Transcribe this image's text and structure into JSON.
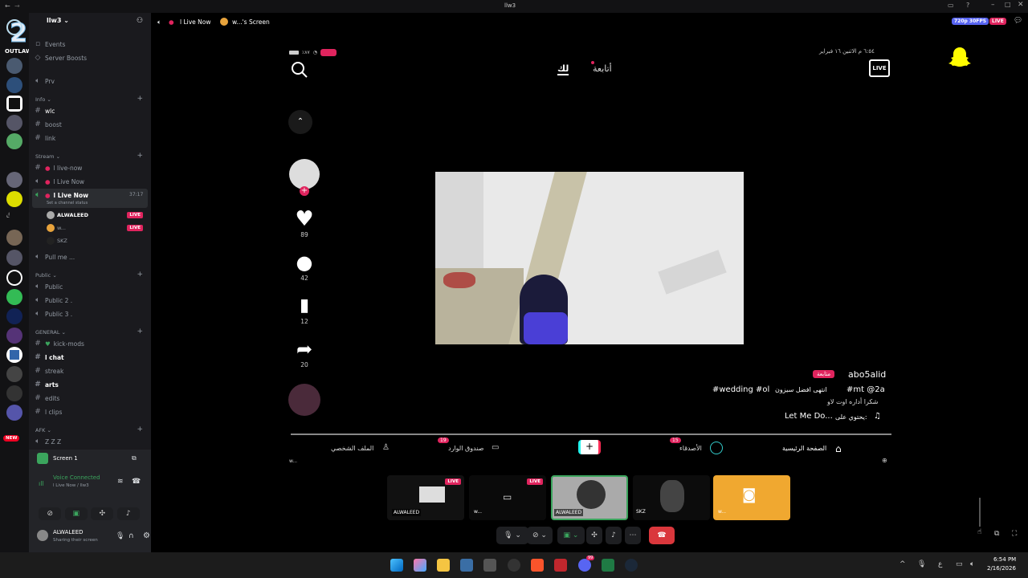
{
  "titlebar": {
    "title": "llw3"
  },
  "guild_logo": {
    "text": "OUTLAW RP"
  },
  "server": {
    "name": "llw3"
  },
  "sidebar": {
    "top_items": [
      {
        "label": "Events"
      },
      {
        "label": "Server Boosts"
      }
    ],
    "prv": {
      "label": "Prv"
    },
    "categories": {
      "info": {
        "label": "Info",
        "channels": [
          {
            "label": "wlc"
          },
          {
            "label": "boost"
          },
          {
            "label": "link"
          }
        ]
      },
      "stream": {
        "label": "Stream",
        "channels": [
          {
            "label": "l live-now"
          },
          {
            "label": "l Live Now"
          },
          {
            "label": "l Live Now"
          }
        ]
      },
      "public": {
        "label": "Public",
        "channels": [
          {
            "label": "Public"
          },
          {
            "label": "Public 2 ."
          },
          {
            "label": "Public 3 ."
          }
        ]
      },
      "general": {
        "label": "GENERAL",
        "channels": [
          {
            "label": "kick-mods"
          },
          {
            "label": "l chat"
          },
          {
            "label": "streak"
          },
          {
            "label": "arts"
          },
          {
            "label": "edits"
          },
          {
            "label": "l clips"
          }
        ]
      },
      "afk": {
        "label": "AFK",
        "channels": [
          {
            "label": "Z Z Z"
          }
        ]
      }
    },
    "active_voice": {
      "timer": "37:17",
      "status": "Set a channel status"
    },
    "voice_users": [
      {
        "name": "ALWALEED",
        "badge": "LIVE"
      },
      {
        "name": "w...",
        "badge": "LIVE"
      },
      {
        "name": "SKZ"
      }
    ],
    "pull_me": {
      "label": "Pull me ..."
    },
    "new_badge": "NEW"
  },
  "screen_panel": {
    "label": "Screen 1"
  },
  "voice_connected": {
    "title": "Voice Connected",
    "subtitle": "l Live Now / llw3"
  },
  "user": {
    "name": "ALWALEED",
    "status": "Sharing their screen"
  },
  "topbar": {
    "channel": "l Live Now",
    "screen_label": "w...'s Screen",
    "quality": "720p 30FPS",
    "live": "LIVE"
  },
  "tiktok": {
    "status_time": "٦:٥٤ م  الاثنين ١٦ فبراير",
    "battery": "٪٨٧",
    "tab_following": "أتابعة",
    "tab_foryou": "لك",
    "live_label": "LIVE",
    "likes": "89",
    "comments": "42",
    "saves": "12",
    "shares": "20",
    "author": "abo5alid",
    "follow": "متابعة",
    "line1": "#mt @2a",
    "line2": "#wedding #ol",
    "line2_ar": "انتهى افضل سيزون",
    "line3": "شكرا أداره اوت لاو",
    "music": "Let Me Do...",
    "music_prefix": "يحتوي على:",
    "nav": {
      "home": "الصفحة الرئيسية",
      "friends": "الأصدقاء",
      "friends_count": "15",
      "inbox": "صندوق الوارد",
      "inbox_count": "19",
      "profile": "الملف الشخصي"
    },
    "bottom_label": "w..."
  },
  "tiles": [
    {
      "name": "ALWALEED",
      "badge": "LIVE"
    },
    {
      "name": "w...",
      "badge": "LIVE"
    },
    {
      "name": "ALWALEED"
    },
    {
      "name": "SKZ"
    },
    {
      "name": "w..."
    }
  ],
  "taskbar": {
    "time": "6:54 PM",
    "date": "2/16/2026",
    "notif": "99"
  }
}
